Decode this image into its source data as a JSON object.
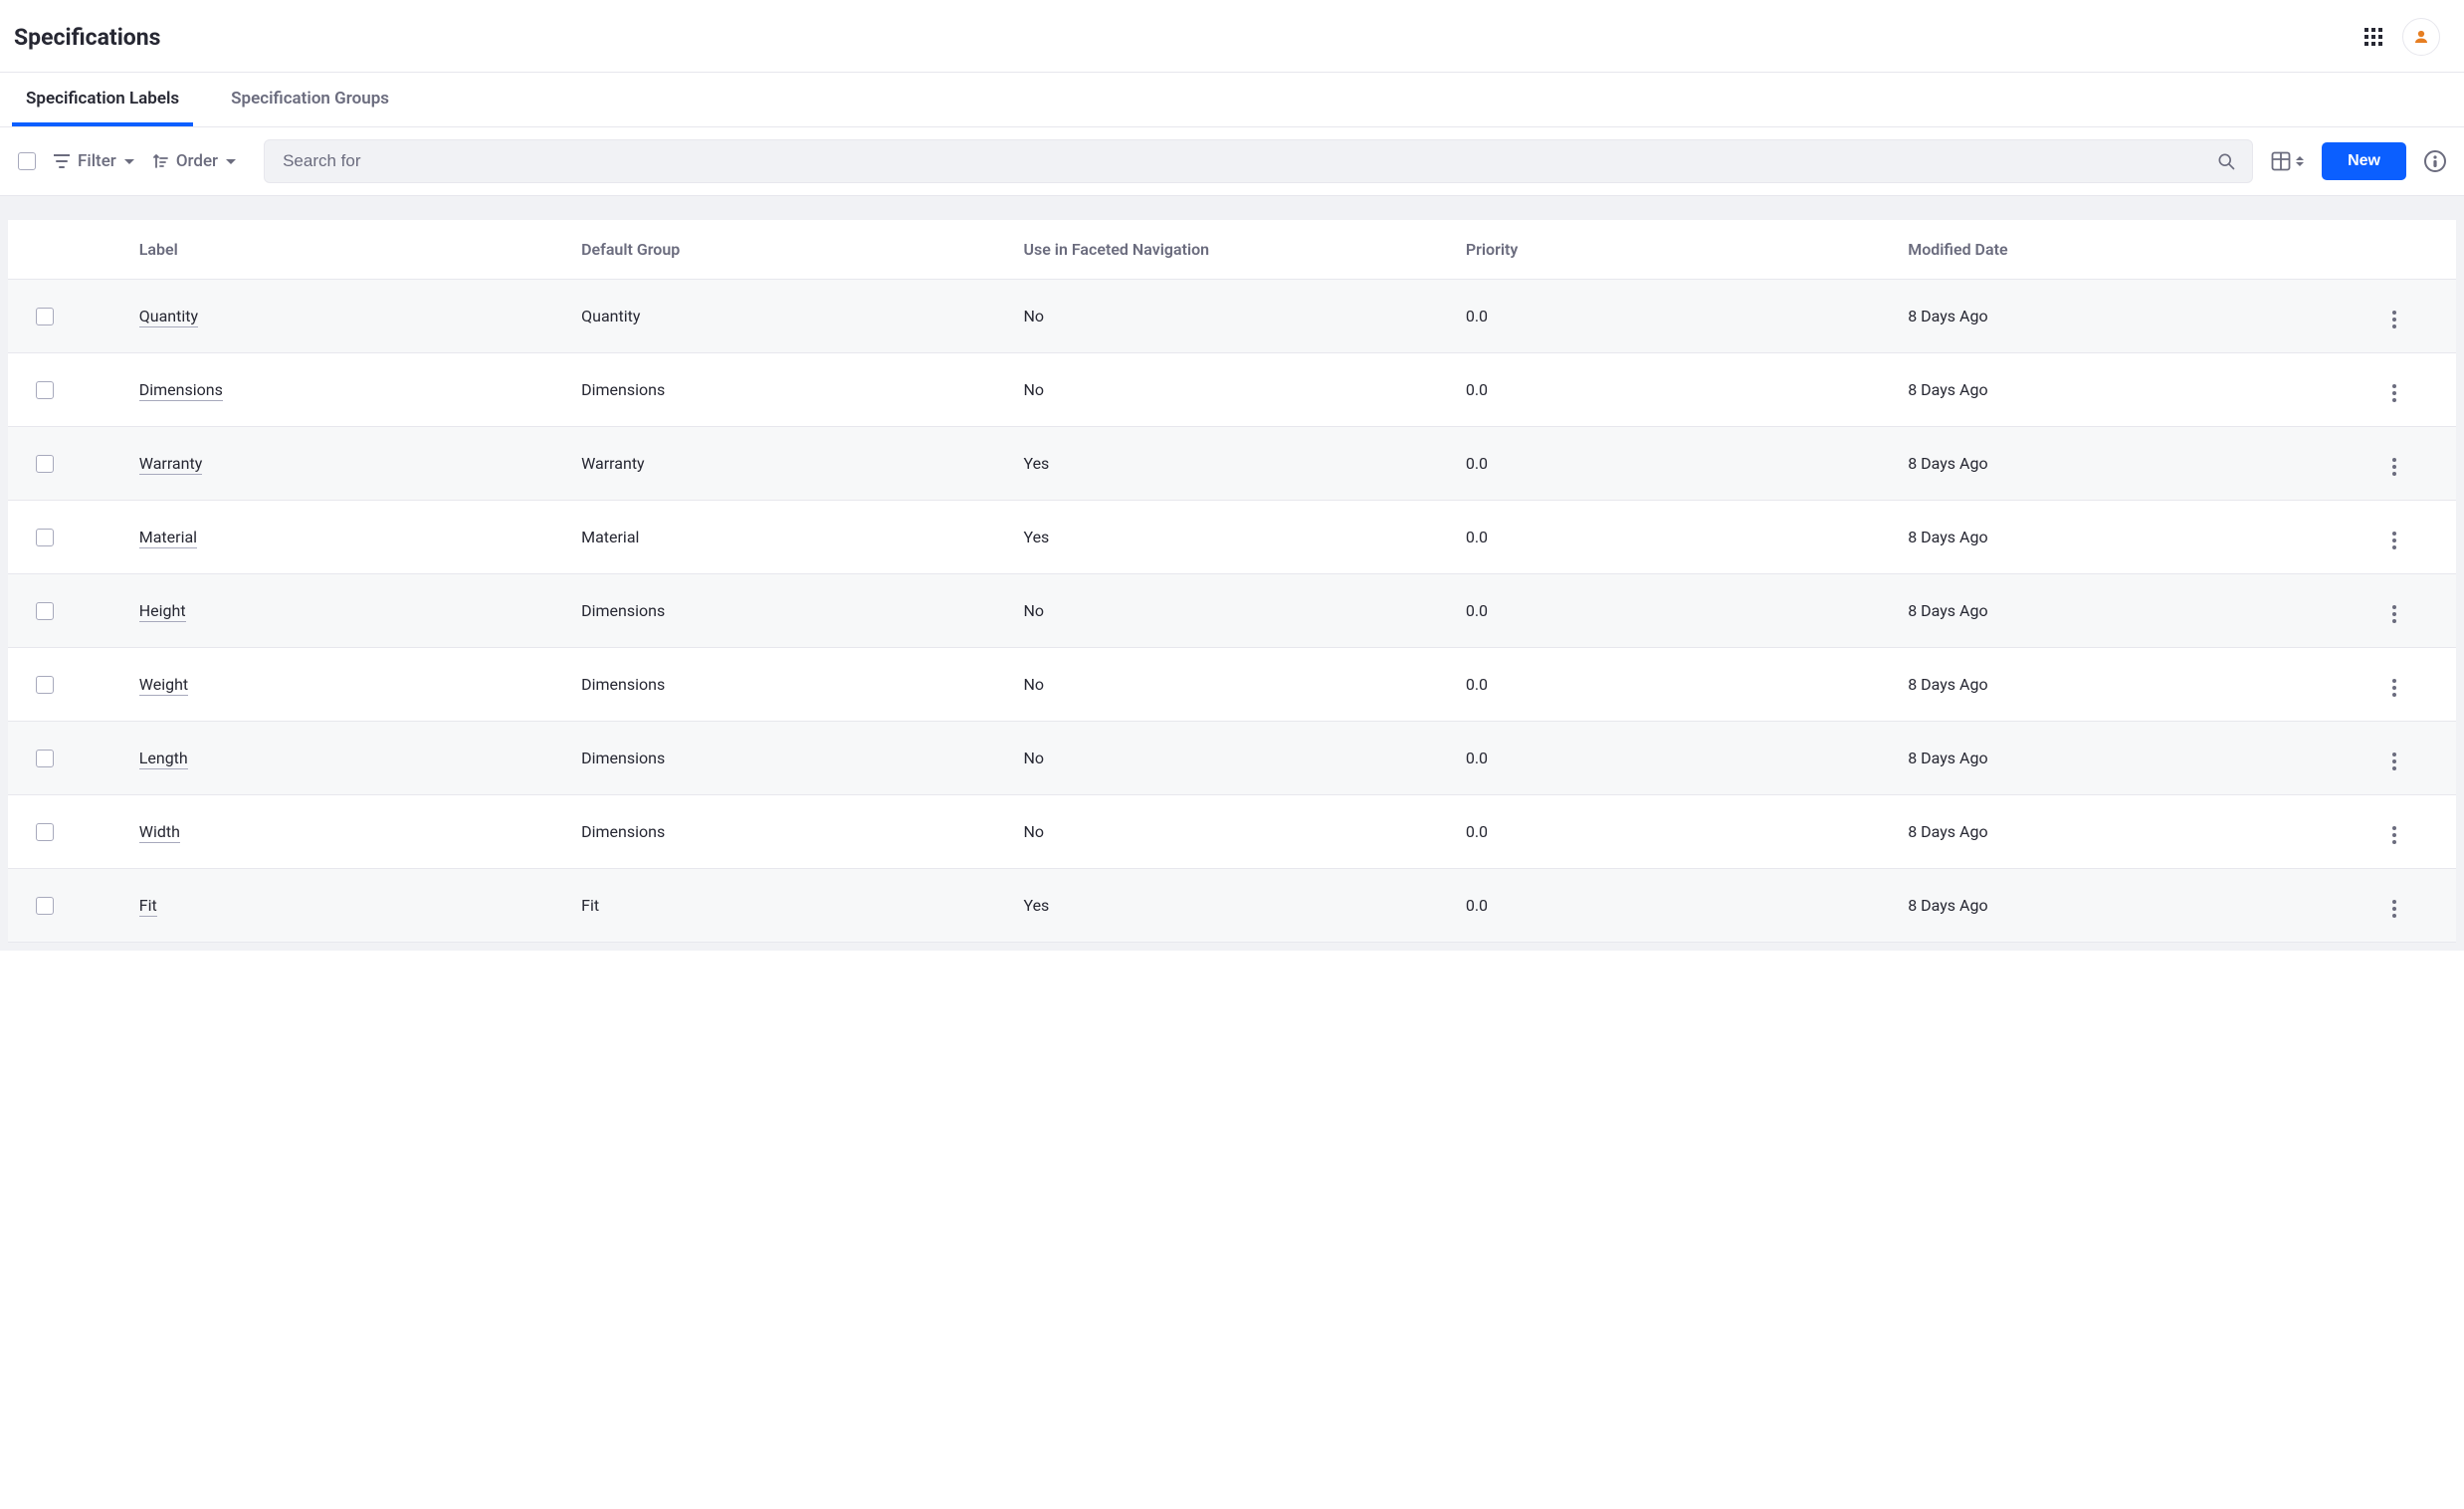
{
  "header": {
    "title": "Specifications"
  },
  "tabs": {
    "labels": "Specification Labels",
    "groups": "Specification Groups"
  },
  "toolbar": {
    "filter_label": "Filter",
    "order_label": "Order",
    "search_placeholder": "Search for",
    "new_label": "New"
  },
  "columns": {
    "label": "Label",
    "default_group": "Default Group",
    "faceted": "Use in Faceted Navigation",
    "priority": "Priority",
    "modified": "Modified Date"
  },
  "rows": [
    {
      "label": "Quantity",
      "group": "Quantity",
      "faceted": "No",
      "priority": "0.0",
      "modified": "8 Days Ago"
    },
    {
      "label": "Dimensions",
      "group": "Dimensions",
      "faceted": "No",
      "priority": "0.0",
      "modified": "8 Days Ago"
    },
    {
      "label": "Warranty",
      "group": "Warranty",
      "faceted": "Yes",
      "priority": "0.0",
      "modified": "8 Days Ago"
    },
    {
      "label": "Material",
      "group": "Material",
      "faceted": "Yes",
      "priority": "0.0",
      "modified": "8 Days Ago"
    },
    {
      "label": "Height",
      "group": "Dimensions",
      "faceted": "No",
      "priority": "0.0",
      "modified": "8 Days Ago"
    },
    {
      "label": "Weight",
      "group": "Dimensions",
      "faceted": "No",
      "priority": "0.0",
      "modified": "8 Days Ago"
    },
    {
      "label": "Length",
      "group": "Dimensions",
      "faceted": "No",
      "priority": "0.0",
      "modified": "8 Days Ago"
    },
    {
      "label": "Width",
      "group": "Dimensions",
      "faceted": "No",
      "priority": "0.0",
      "modified": "8 Days Ago"
    },
    {
      "label": "Fit",
      "group": "Fit",
      "faceted": "Yes",
      "priority": "0.0",
      "modified": "8 Days Ago"
    }
  ]
}
